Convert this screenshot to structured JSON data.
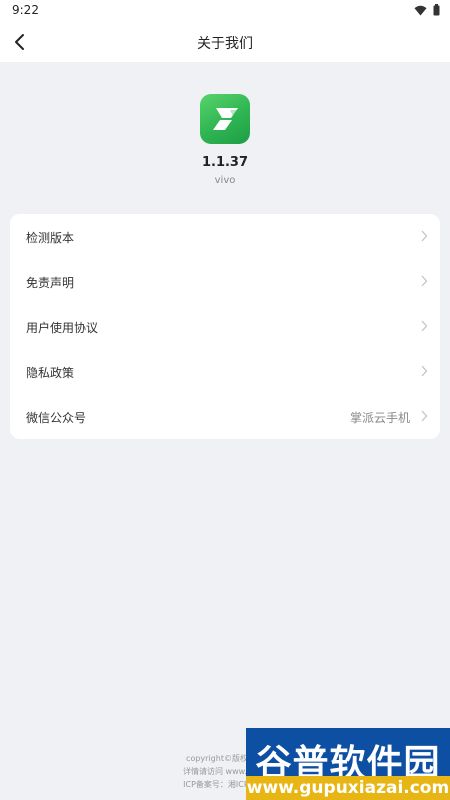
{
  "status_bar": {
    "time": "9:22"
  },
  "nav": {
    "title": "关于我们"
  },
  "app": {
    "version": "1.1.37",
    "channel": "vivo"
  },
  "menu": [
    {
      "label": "检测版本",
      "value": ""
    },
    {
      "label": "免责声明",
      "value": ""
    },
    {
      "label": "用户使用协议",
      "value": ""
    },
    {
      "label": "隐私政策",
      "value": ""
    },
    {
      "label": "微信公众号",
      "value": "掌派云手机"
    }
  ],
  "footer": {
    "line1": "copyright©版权信息",
    "line2": "详情请访问 www.palm",
    "line3": "ICP备案号：湘ICP备20"
  },
  "watermark": {
    "logo_text": "谷普软件园",
    "url": "www.gupuxiazai.com"
  },
  "colors": {
    "accent": "#2eb552",
    "background": "#f0f1f5",
    "card": "#ffffff"
  }
}
